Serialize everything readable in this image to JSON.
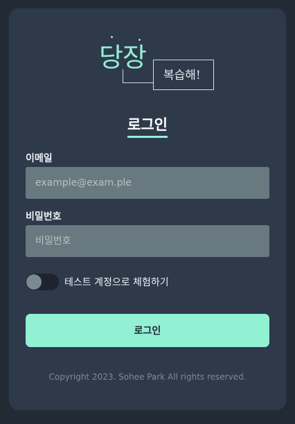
{
  "logo": {
    "big_text": "당장",
    "small_text": "복습해!"
  },
  "title": "로그인",
  "email": {
    "label": "이메일",
    "placeholder": "example@exam.ple"
  },
  "password": {
    "label": "비밀번호",
    "placeholder": "비밀번호"
  },
  "test_account": {
    "label": "테스트 계정으로 체험하기",
    "enabled": false
  },
  "submit_label": "로그인",
  "copyright": "Copyright 2023. Sohee Park All rights reserved.",
  "colors": {
    "accent": "#92f0d3",
    "card": "#2e394a",
    "background": "#222b33",
    "input": "#687a7f"
  }
}
